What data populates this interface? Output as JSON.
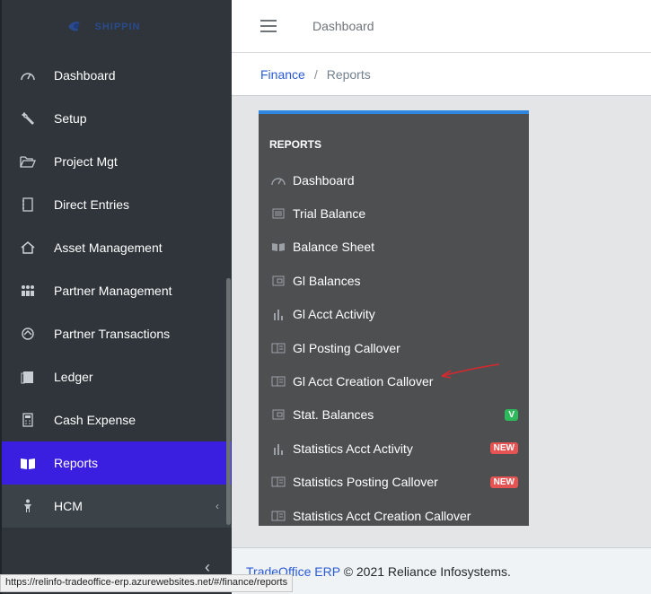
{
  "sidebar": {
    "logo_text": "SHIPPIN",
    "items": [
      {
        "label": "Dashboard"
      },
      {
        "label": "Setup"
      },
      {
        "label": "Project Mgt"
      },
      {
        "label": "Direct Entries"
      },
      {
        "label": "Asset Management"
      },
      {
        "label": "Partner Management"
      },
      {
        "label": "Partner Transactions"
      },
      {
        "label": "Ledger"
      },
      {
        "label": "Cash Expense"
      },
      {
        "label": "Reports"
      },
      {
        "label": "HCM"
      }
    ],
    "active_item": "Reports"
  },
  "header": {
    "link": "Dashboard"
  },
  "breadcrumb": {
    "parent": "Finance",
    "separator": "/",
    "current": "Reports"
  },
  "reports": {
    "title": "REPORTS",
    "items": [
      {
        "label": "Dashboard"
      },
      {
        "label": "Trial Balance"
      },
      {
        "label": "Balance Sheet"
      },
      {
        "label": "Gl Balances"
      },
      {
        "label": "Gl Acct Activity"
      },
      {
        "label": "Gl Posting Callover"
      },
      {
        "label": "Gl Acct Creation Callover"
      },
      {
        "label": "Stat. Balances",
        "badge": "V"
      },
      {
        "label": "Statistics Acct Activity",
        "badge": "NEW"
      },
      {
        "label": "Statistics Posting Callover",
        "badge": "NEW"
      },
      {
        "label": "Statistics Acct Creation Callover"
      }
    ]
  },
  "footer": {
    "brand": "TradeOffice ERP",
    "copyright": "© 2021 Reliance Infosystems."
  },
  "statusbar": {
    "url": "https://relinfo-tradeoffice-erp.azurewebsites.net/#/finance/reports"
  },
  "colors": {
    "sidebar_bg": "#2f353a",
    "active_bg": "#3a1fe0",
    "panel_bg": "#4d4f51",
    "panel_accent": "#2e86de",
    "badge_green": "#2eb85c",
    "badge_red": "#e55353",
    "annotation_arrow": "#d9272e"
  }
}
